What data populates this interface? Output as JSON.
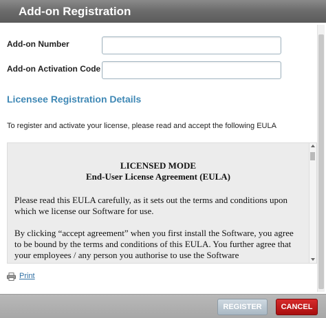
{
  "dialog": {
    "title": "Add-on Registration"
  },
  "form": {
    "addon_number_label": "Add-on Number",
    "addon_number_value": "",
    "activation_code_label": "Add-on Activation Code",
    "activation_code_value": ""
  },
  "section": {
    "heading": "Licensee Registration Details",
    "intro": "To register and activate your license, please read and accept the following EULA"
  },
  "eula": {
    "title_line1": "LICENSED MODE",
    "title_line2": "End-User License Agreement (EULA)",
    "paragraph1": "Please read this EULA carefully, as it sets out the terms and conditions upon which we license our Software for use.",
    "paragraph2": "By clicking “accept agreement” when you first install the Software, you agree to be bound by the terms and conditions of this EULA. You further agree that your employees / any person you authorise to use the Software"
  },
  "print": {
    "label": "Print",
    "icon": "printer-icon"
  },
  "footer": {
    "register_label": "REGISTER",
    "cancel_label": "CANCEL"
  },
  "colors": {
    "heading_accent": "#3f88b5",
    "cancel_button": "#c01c1c",
    "register_button": "#b9c6d1",
    "titlebar": "#6d6d6d"
  }
}
